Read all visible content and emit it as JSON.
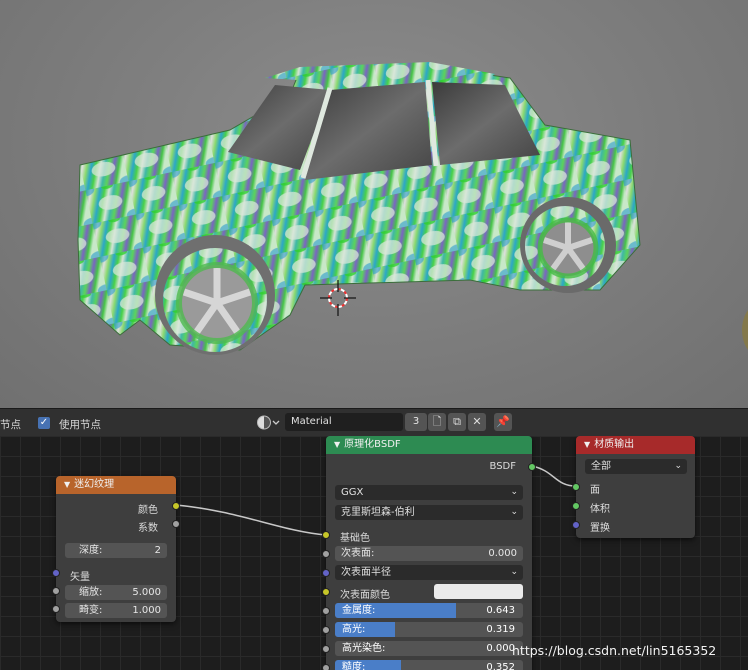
{
  "header": {
    "left_label": "节点",
    "use_nodes_label": "使用节点",
    "material_name": "Material",
    "material_users": "3"
  },
  "icons": [
    "sphere-material-icon",
    "new-material-icon",
    "duplicate-icon",
    "close-icon",
    "pin-icon",
    "check-icon"
  ],
  "colors": {
    "noise_header": "#b8642b",
    "bsdf_header": "#2d8b52",
    "output_header": "#a72a2a",
    "socket_color": "#c7c729",
    "socket_float": "#a1a1a1",
    "socket_vector": "#6363c7",
    "socket_shader": "#63c763",
    "slider_fill": "#4a7ec8"
  },
  "nodes": {
    "magic_texture": {
      "title": "迷幻纹理",
      "out_color": "颜色",
      "out_fac": "系数",
      "depth_label": "深度:",
      "depth_value": "2",
      "vector_label": "矢量",
      "scale_label": "缩放:",
      "scale_value": "5.000",
      "distortion_label": "畸变:",
      "distortion_value": "1.000"
    },
    "principled_bsdf": {
      "title": "原理化BSDF",
      "out_bsdf": "BSDF",
      "distribution": "GGX",
      "subsurface_method": "克里斯坦森-伯利",
      "base_color_label": "基础色",
      "subsurface_label": "次表面:",
      "subsurface_value": "0.000",
      "subsurface_radius_label": "次表面半径",
      "subsurface_color_label": "次表面颜色",
      "metallic_label": "金属度:",
      "metallic_value": "0.643",
      "metallic_fraction": 0.643,
      "specular_label": "高光:",
      "specular_value": "0.319",
      "specular_fraction": 0.319,
      "specular_tint_label": "高光染色:",
      "specular_tint_value": "0.000",
      "roughness_label": "糙度:",
      "roughness_value": "0.352",
      "roughness_fraction": 0.352
    },
    "material_output": {
      "title": "材质输出",
      "target": "全部",
      "in_surface": "面",
      "in_volume": "体积",
      "in_displacement": "置换"
    }
  },
  "watermark": "https://blog.csdn.net/lin5165352"
}
